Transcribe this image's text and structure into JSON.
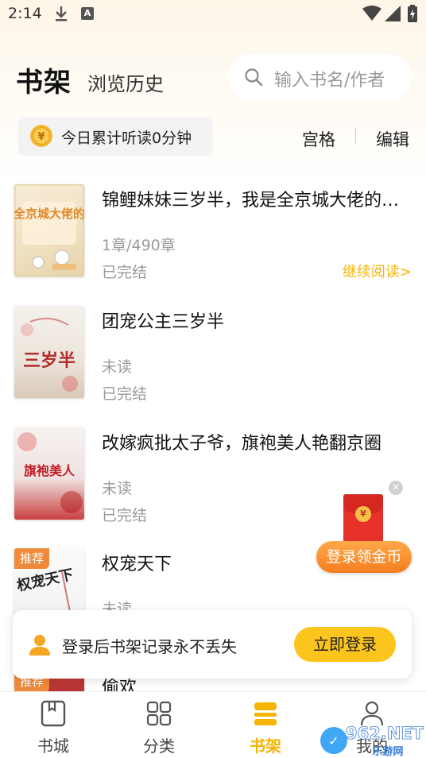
{
  "status_bar": {
    "time": "2:14",
    "notif_letter": "A"
  },
  "header": {
    "title": "书架",
    "history_tab": "浏览历史",
    "search_placeholder": "输入书名/作者"
  },
  "toolbar": {
    "today_text": "今日累计听读0分钟",
    "grid_label": "宫格",
    "edit_label": "编辑"
  },
  "books": [
    {
      "title": "锦鲤妹妹三岁半，我是全京城大佬的…",
      "progress": "1章/490章",
      "status": "已完结",
      "action": "继续阅读>",
      "cover_text": "我是全京城大佬的团宠"
    },
    {
      "title": "团宠公主三岁半",
      "progress": "未读",
      "status": "已完结",
      "cover_text": "三岁半"
    },
    {
      "title": "改嫁疯批太子爷，旗袍美人艳翻京圈",
      "progress": "未读",
      "status": "已完结",
      "cover_text": "旗袍美人"
    },
    {
      "title": "权宠天下",
      "progress": "未读",
      "tag": "推荐",
      "cover_text": "权宠天下"
    },
    {
      "title": "偷欢",
      "tag": "推荐"
    }
  ],
  "promo": {
    "close": "×",
    "coin_symbol": "¥",
    "button": "登录领金币"
  },
  "login_banner": {
    "text": "登录后书架记录永不丢失",
    "button": "立即登录"
  },
  "bottom_nav": [
    {
      "label": "书城",
      "icon": "bookstore-icon",
      "active": false
    },
    {
      "label": "分类",
      "icon": "category-icon",
      "active": false
    },
    {
      "label": "书架",
      "icon": "bookshelf-icon",
      "active": true
    },
    {
      "label": "我的",
      "icon": "profile-icon",
      "active": false
    }
  ],
  "watermark": {
    "text": "962.NET",
    "subtext": "乐游网"
  },
  "colors": {
    "accent": "#f5b400",
    "login_button": "#fcc51e",
    "promo_orange": "#f57d1f",
    "tag_orange": "#f08a3a",
    "red_packet": "#e8302a"
  }
}
